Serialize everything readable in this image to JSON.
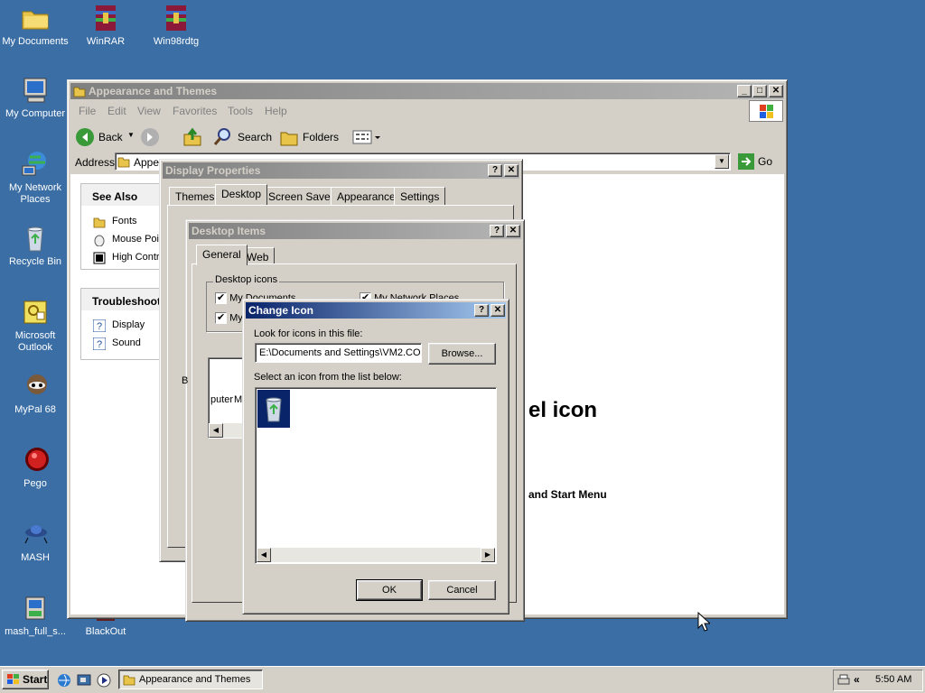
{
  "desktop": {
    "icons": [
      {
        "label": "My Documents",
        "icon": "folder-icon"
      },
      {
        "label": "WinRAR",
        "icon": "winrar-icon"
      },
      {
        "label": "Win98rdtg",
        "icon": "winrar-icon"
      },
      {
        "label": "My Computer",
        "icon": "computer-icon"
      },
      {
        "label": "My Network Places",
        "icon": "network-icon"
      },
      {
        "label": "Recycle Bin",
        "icon": "recycle-bin-icon"
      },
      {
        "label": "Microsoft Outlook",
        "icon": "outlook-icon"
      },
      {
        "label": "MyPal 68",
        "icon": "mypal-icon"
      },
      {
        "label": "Pego",
        "icon": "pego-icon"
      },
      {
        "label": "MASH",
        "icon": "mash-icon"
      },
      {
        "label": "mash_full_s...",
        "icon": "installer-icon"
      },
      {
        "label": "BlackOut",
        "icon": "blackout-icon"
      }
    ]
  },
  "explorer": {
    "title": "Appearance and Themes",
    "menu": [
      "File",
      "Edit",
      "View",
      "Favorites",
      "Tools",
      "Help"
    ],
    "toolbar": {
      "back": "Back",
      "search": "Search",
      "folders": "Folders"
    },
    "address_label": "Address",
    "address_value": "Appea",
    "go": "Go",
    "see_also": {
      "title": "See Also",
      "items": [
        "Fonts",
        "Mouse Poin",
        "High Contr"
      ]
    },
    "troubleshoot": {
      "title": "Troubleshoot",
      "items": [
        "Display",
        "Sound"
      ]
    },
    "main_heading_fragment": "el icon",
    "main_link_fragment": "and Start Menu"
  },
  "display_properties": {
    "title": "Display Properties",
    "tabs": [
      "Themes",
      "Desktop",
      "Screen Saver",
      "Appearance",
      "Settings"
    ],
    "selected_tab": "Desktop"
  },
  "desktop_items": {
    "title": "Desktop Items",
    "tabs": [
      "General",
      "Web"
    ],
    "group_label": "Desktop icons",
    "checkboxes": [
      "My Documents",
      "My Network Places",
      "My"
    ],
    "fragment_b": "B",
    "list_fragments": [
      "puter",
      "M"
    ]
  },
  "change_icon": {
    "title": "Change Icon",
    "look_label": "Look for icons in this file:",
    "file_path": "E:\\Documents and Settings\\VM2.COL",
    "browse": "Browse...",
    "select_label": "Select an icon from the list below:",
    "ok": "OK",
    "cancel": "Cancel"
  },
  "taskbar": {
    "start": "Start",
    "task": "Appearance and Themes",
    "time": "5:50 AM",
    "chevron": "«"
  },
  "colors": {
    "desktop": "#3a6ea5",
    "active_title": "#0a246a",
    "inactive_title": "#808080",
    "face": "#d4d0c8"
  }
}
